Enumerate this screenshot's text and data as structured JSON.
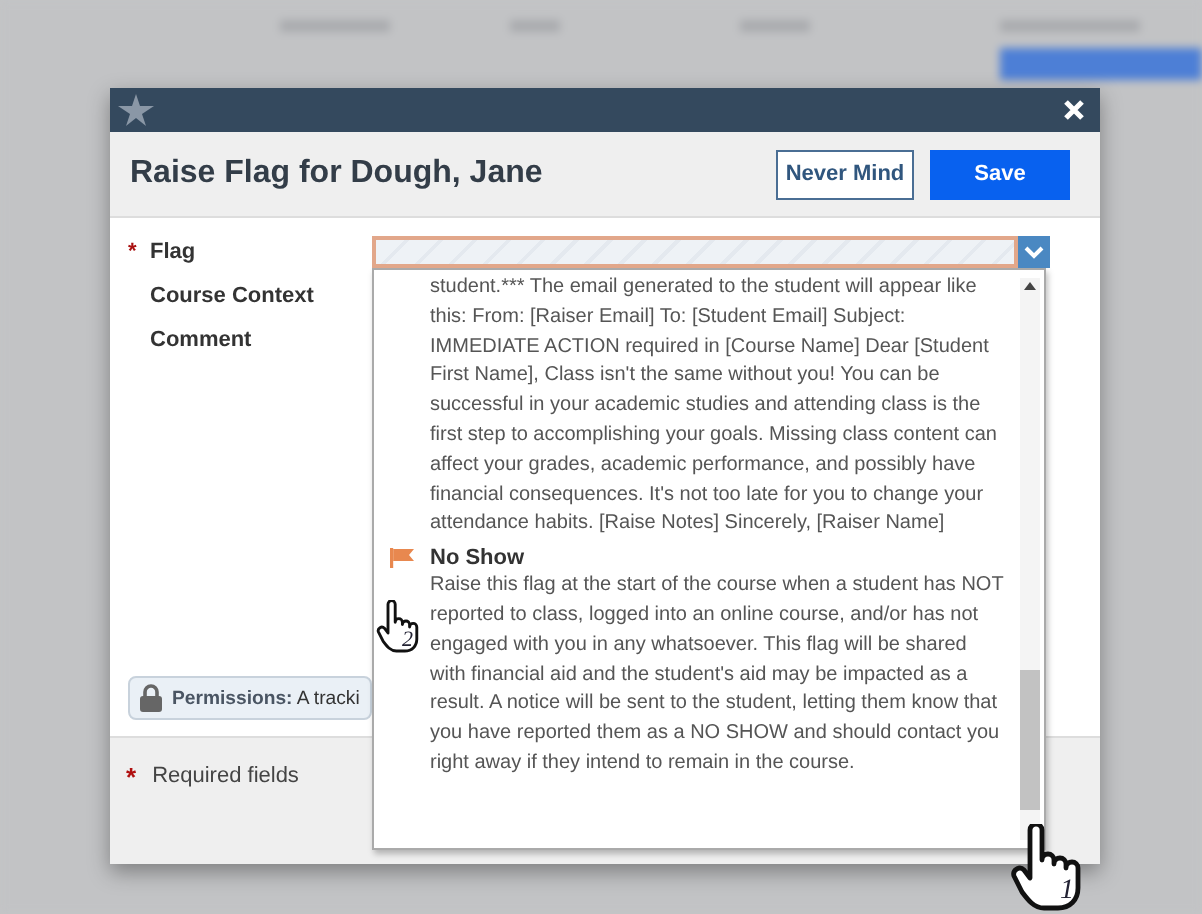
{
  "modal": {
    "title": "Raise Flag for Dough, Jane",
    "buttons": [
      {
        "label": "Never Mind",
        "kind": "secondary"
      },
      {
        "label": "Save",
        "kind": "primary"
      }
    ],
    "required_mark": "*",
    "fields": [
      {
        "label": "Flag",
        "required": true
      },
      {
        "label": "Course Context",
        "required": false
      },
      {
        "label": "Comment",
        "required": false
      }
    ],
    "permissions": {
      "label": "Permissions:",
      "text": "A tracki"
    },
    "required_note": "Required fields"
  },
  "dropdown": {
    "options": [
      {
        "description": "student.*** The email generated to the student will appear like this: From: [Raiser Email] To: [Student Email] Subject: IMMEDIATE ACTION required in [Course Name] Dear [Student First Name], Class isn't the same without you! You can be successful in your academic studies and attending class is the first step to accomplishing your goals. Missing class content can affect your grades, academic performance, and possibly have financial consequences. It's not too late for you to change your attendance habits. [Raise Notes] Sincerely, [Raiser Name]"
      },
      {
        "name": "No Show",
        "description": "Raise this flag at the start of the course when a student has NOT reported to class, logged into an online course, and/or has not engaged with you in any whatsoever. This flag will be shared with financial aid and the student's aid may be impacted as a result. A notice will be sent to the student, letting them know that you have reported them as a NO SHOW and should contact you right away if they intend to remain in the course."
      }
    ]
  },
  "cursors": [
    {
      "number": "2"
    },
    {
      "number": "1"
    }
  ]
}
